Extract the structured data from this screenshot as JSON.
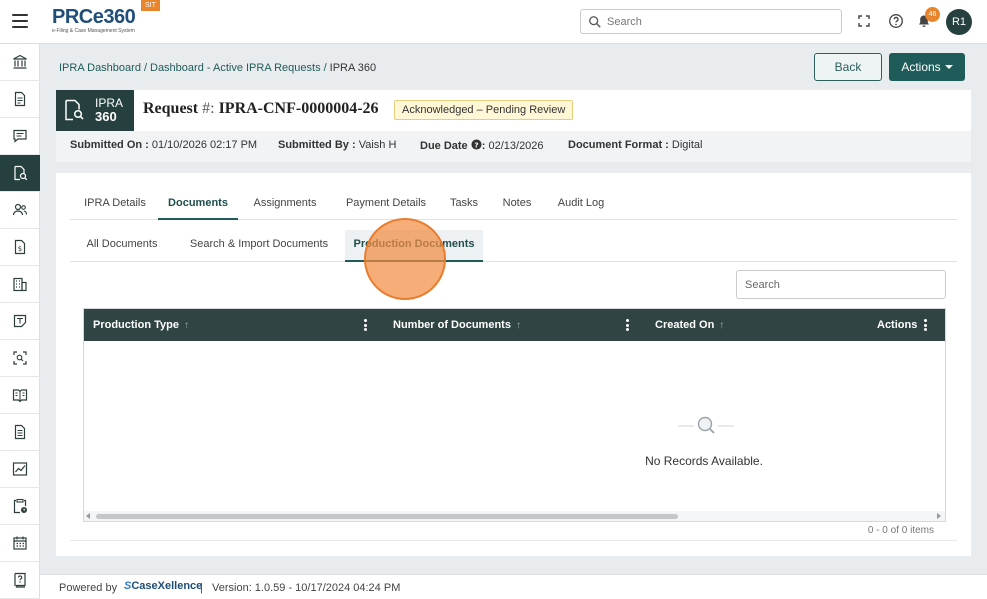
{
  "brand": {
    "logo_text": "PRCe360",
    "logo_subtitle": "e-Filing & Case Management System",
    "env_badge": "SIT"
  },
  "topbar": {
    "search_placeholder": "Search",
    "notification_count": "46",
    "avatar_initials": "R1",
    "icons": [
      "menu-icon",
      "search-icon",
      "fullscreen-icon",
      "help-icon",
      "bell-icon"
    ]
  },
  "sidebar": {
    "items": [
      {
        "icon": "bank-icon",
        "active": false
      },
      {
        "icon": "document-icon",
        "active": false
      },
      {
        "icon": "chat-icon",
        "active": false
      },
      {
        "icon": "document-search-icon",
        "active": true
      },
      {
        "icon": "users-icon",
        "active": false
      },
      {
        "icon": "invoice-icon",
        "active": false
      },
      {
        "icon": "building-icon",
        "active": false
      },
      {
        "icon": "note-icon",
        "active": false
      },
      {
        "icon": "scan-icon",
        "active": false
      },
      {
        "icon": "book-icon",
        "active": false
      },
      {
        "icon": "file-text-icon",
        "active": false
      },
      {
        "icon": "chart-icon",
        "active": false
      },
      {
        "icon": "clipboard-clock-icon",
        "active": false
      },
      {
        "icon": "calendar-icon",
        "active": false
      },
      {
        "icon": "help-book-icon",
        "active": false
      }
    ]
  },
  "breadcrumb": {
    "items": [
      "IPRA Dashboard",
      "Dashboard - Active IPRA Requests"
    ],
    "separator": "/",
    "current": "IPRA 360"
  },
  "header_buttons": {
    "back": "Back",
    "actions": "Actions"
  },
  "request": {
    "badge_line1": "IPRA",
    "badge_line2": "360",
    "title_label": "Request",
    "title_hash": "#:",
    "title_id": "IPRA-CNF-0000004-26",
    "status": "Acknowledged – Pending Review",
    "summary": {
      "submitted_on_label": "Submitted On :",
      "submitted_on": "01/10/2026 02:17 PM",
      "submitted_by_label": "Submitted By :",
      "submitted_by": "Vaish H",
      "due_date_label": "Due Date",
      "due_date_sep": ":",
      "due_date": "02/13/2026",
      "doc_format_label": "Document Format :",
      "doc_format": "Digital"
    }
  },
  "tabs": [
    {
      "label": "IPRA Details",
      "active": false
    },
    {
      "label": "Documents",
      "active": true
    },
    {
      "label": "Assignments",
      "active": false
    },
    {
      "label": "Payment Details",
      "active": false
    },
    {
      "label": "Tasks",
      "active": false
    },
    {
      "label": "Notes",
      "active": false
    },
    {
      "label": "Audit Log",
      "active": false
    }
  ],
  "subtabs": [
    {
      "label": "All Documents",
      "active": false
    },
    {
      "label": "Search & Import Documents",
      "active": false
    },
    {
      "label": "Production Documents",
      "active": true
    }
  ],
  "grid": {
    "search_placeholder": "Search",
    "columns": [
      "Production Type",
      "Number of Documents",
      "Created On",
      "Actions"
    ],
    "sort_glyph": "↑",
    "empty_message": "No Records Available.",
    "items_summary": "0 - 0 of 0 items"
  },
  "footer": {
    "powered_by": "Powered by",
    "vendor": "CaseXellence",
    "separator": "|",
    "version": "Version: 1.0.59 - 10/17/2024 04:24 PM"
  },
  "colors": {
    "brand_dark": "#25403e",
    "accent_teal": "#1f5b58",
    "badge_orange": "#e8842c",
    "status_bg": "#fff7d6"
  }
}
